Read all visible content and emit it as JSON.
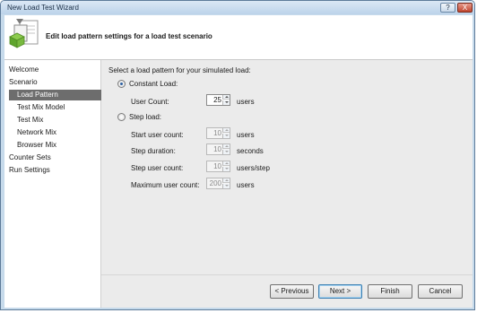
{
  "window": {
    "title": "New Load Test Wizard",
    "help_glyph": "?",
    "close_glyph": "X"
  },
  "header": {
    "title": "Edit load pattern settings for a load test scenario"
  },
  "sidebar": {
    "items": [
      {
        "label": "Welcome"
      },
      {
        "label": "Scenario"
      },
      {
        "label": "Load Pattern",
        "selected": true
      },
      {
        "label": "Test Mix Model"
      },
      {
        "label": "Test Mix"
      },
      {
        "label": "Network Mix"
      },
      {
        "label": "Browser Mix"
      },
      {
        "label": "Counter Sets"
      },
      {
        "label": "Run Settings"
      }
    ]
  },
  "main": {
    "prompt": "Select a load pattern for your simulated load:",
    "constant": {
      "label": "Constant Load:",
      "selected": true,
      "user_count_label": "User Count:",
      "user_count": "25",
      "user_count_unit": "users"
    },
    "step": {
      "label": "Step load:",
      "selected": false,
      "start_label": "Start user count:",
      "start_value": "10",
      "start_unit": "users",
      "duration_label": "Step duration:",
      "duration_value": "10",
      "duration_unit": "seconds",
      "step_count_label": "Step user count:",
      "step_count_value": "10",
      "step_count_unit": "users/step",
      "max_label": "Maximum user count:",
      "max_value": "200",
      "max_unit": "users"
    }
  },
  "footer": {
    "previous": "< Previous",
    "next": "Next >",
    "finish": "Finish",
    "cancel": "Cancel"
  },
  "colors": {
    "frame": "#c6daeb",
    "selected_nav": "#6d6d6d",
    "content_bg": "#ebebeb"
  }
}
